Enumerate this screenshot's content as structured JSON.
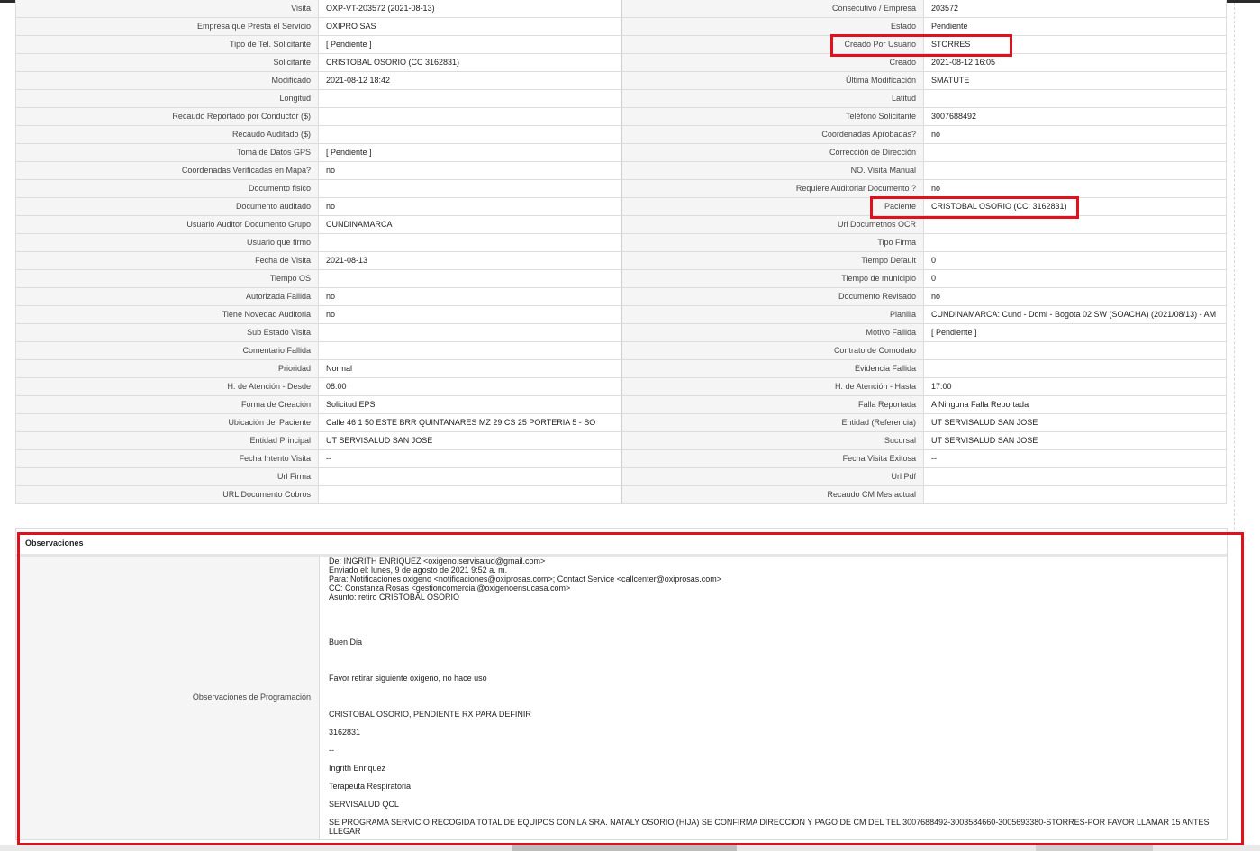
{
  "details": [
    {
      "l1": "Visita",
      "v1": "OXP-VT-203572 (2021-08-13)",
      "l2": "Consecutivo / Empresa",
      "v2": "203572"
    },
    {
      "l1": "Empresa que Presta el Servicio",
      "v1": "OXIPRO SAS",
      "l2": "Estado",
      "v2": "Pendiente"
    },
    {
      "l1": "Tipo de Tel. Solicitante",
      "v1": "[ Pendiente ]",
      "l2": "Creado Por Usuario",
      "v2": "STORRES"
    },
    {
      "l1": "Solicitante",
      "v1": "CRISTOBAL OSORIO (CC 3162831)",
      "l2": "Creado",
      "v2": "2021-08-12 16:05"
    },
    {
      "l1": "Modificado",
      "v1": "2021-08-12 18:42",
      "l2": "Última Modificación",
      "v2": " SMATUTE"
    },
    {
      "l1": "Longitud",
      "v1": "",
      "l2": "Latitud",
      "v2": ""
    },
    {
      "l1": "Recaudo Reportado por Conductor ($)",
      "v1": "",
      "l2": "Teléfono Solicitante",
      "v2": "3007688492"
    },
    {
      "l1": "Recaudo Auditado ($)",
      "v1": "",
      "l2": "Coordenadas Aprobadas?",
      "v2": " no"
    },
    {
      "l1": "Toma de Datos GPS",
      "v1": "[ Pendiente ]",
      "l2": "Corrección de Dirección",
      "v2": ""
    },
    {
      "l1": "Coordenadas Verificadas en Mapa?",
      "v1": " no",
      "l2": "NO. Visita Manual",
      "v2": ""
    },
    {
      "l1": "Documento fisico",
      "v1": "",
      "l2": "Requiere Auditoriar Documento ?",
      "v2": " no"
    },
    {
      "l1": "Documento auditado",
      "v1": " no",
      "l2": "Paciente",
      "v2": "CRISTOBAL OSORIO (CC: 3162831)"
    },
    {
      "l1": "Usuario Auditor Documento Grupo",
      "v1": "CUNDINAMARCA",
      "l2": "Url Documetnos OCR",
      "v2": ""
    },
    {
      "l1": "Usuario que firmo",
      "v1": "",
      "l2": "Tipo Firma",
      "v2": ""
    },
    {
      "l1": "Fecha de Visita",
      "v1": " 2021-08-13",
      "l2": "Tiempo Default",
      "v2": "0"
    },
    {
      "l1": "Tiempo OS",
      "v1": "",
      "l2": "Tiempo de municipio",
      "v2": "0"
    },
    {
      "l1": "Autorizada Fallida",
      "v1": " no",
      "l2": "Documento Revisado",
      "v2": " no"
    },
    {
      "l1": "Tiene Novedad Auditoria",
      "v1": " no",
      "l2": "Planilla",
      "v2": "CUNDINAMARCA: Cund - Domi - Bogota 02 SW (SOACHA) (2021/08/13) - AM"
    },
    {
      "l1": "Sub Estado Visita",
      "v1": "",
      "l2": "Motivo Fallida",
      "v2": "[ Pendiente ]"
    },
    {
      "l1": "Comentario Fallida",
      "v1": "",
      "l2": "Contrato de Comodato",
      "v2": ""
    },
    {
      "l1": "Prioridad",
      "v1": "Normal",
      "l2": "Evidencia Fallida",
      "v2": ""
    },
    {
      "l1": "H. de Atención - Desde",
      "v1": "08:00",
      "l2": "H. de Atención - Hasta",
      "v2": "17:00"
    },
    {
      "l1": "Forma de Creación",
      "v1": "Solicitud EPS",
      "l2": "Falla Reportada",
      "v2": "A Ninguna Falla Reportada"
    },
    {
      "l1": "Ubicación del Paciente",
      "v1": "Calle 46 1 50 ESTE BRR QUINTANARES MZ 29 CS 25 PORTERIA 5 - SO",
      "l2": "Entidad (Referencia)",
      "v2": "UT SERVISALUD SAN JOSE"
    },
    {
      "l1": "Entidad Principal",
      "v1": "UT SERVISALUD SAN JOSE",
      "l2": "Sucursal",
      "v2": "UT SERVISALUD SAN JOSE"
    },
    {
      "l1": "Fecha Intento Visita",
      "v1": " --",
      "l2": "Fecha Visita Exitosa",
      "v2": " --"
    },
    {
      "l1": "Url Firma",
      "v1": "",
      "l2": "Url Pdf",
      "v2": ""
    },
    {
      "l1": "URL Documento Cobros",
      "v1": "",
      "l2": "Recaudo CM Mes actual",
      "v2": ""
    }
  ],
  "observations": {
    "header": "Observaciones",
    "label": "Observaciones de Programación",
    "lines": [
      " De: INGRITH ENRIQUEZ <oxigeno.servisalud@gmail.com>",
      "Enviado el: lunes, 9 de agosto de 2021 9:52 a. m.",
      "Para: Notificaciones oxigeno <notificaciones@oxiprosas.com>; Contact Service <callcenter@oxiprosas.com>",
      "CC: Constanza Rosas <gestioncomercial@oxigenoensucasa.com>",
      "Asunto: retiro CRISTOBAL OSORIO",
      "Buen Dia",
      "Favor retirar siguiente oxigeno, no hace uso",
      "CRISTOBAL OSORIO, PENDIENTE RX PARA DEFINIR",
      "3162831",
      "--",
      "Ingrith Enriquez",
      "Terapeuta Respiratoria",
      "SERVISALUD QCL",
      " SE PROGRAMA SERVICIO RECOGIDA TOTAL DE EQUIPOS CON LA SRA. NATALY OSORIO (HIJA) SE CONFIRMA DIRECCION Y PAGO DE CM DEL TEL 3007688492-3003584660-3005693380-STORRES-POR FAVOR LLAMAR 15 ANTES LLEGAR"
    ]
  },
  "colors": {
    "highlight": "#e0101c",
    "label_bg": "#f5f5f5",
    "border": "#dddddd"
  }
}
